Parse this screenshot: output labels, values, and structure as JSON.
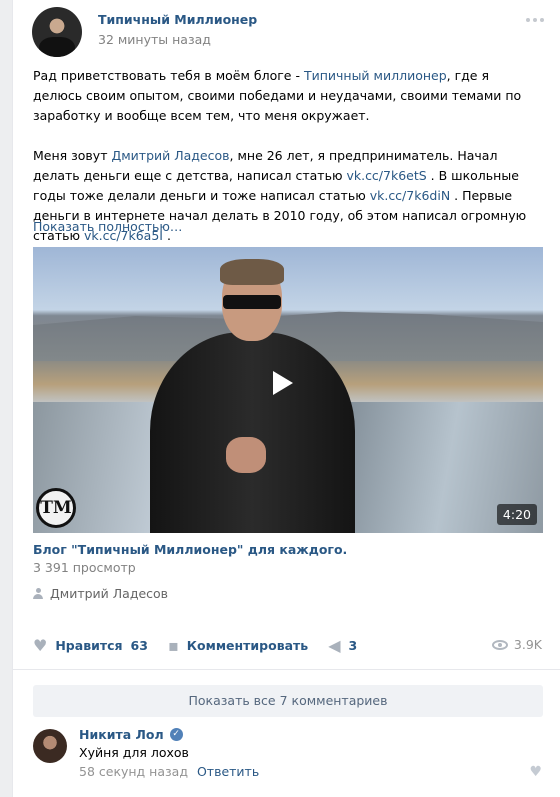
{
  "post": {
    "author": "Типичный Миллионер",
    "time": "32 минуты назад",
    "paragraph1": {
      "before": "Рад приветствовать тебя в моём блоге - ",
      "link": "Типичный миллионер",
      "after": ", где я делюсь своим опытом, своими победами и неудачами, своими темами по заработку и вообще всем тем, что меня окружает."
    },
    "paragraph2": {
      "t1": "Меня зовут ",
      "name_link": "Дмитрий Ладесов",
      "t2": ", мне 26 лет, я предприниматель. Начал делать деньги еще с детства, написал статью ",
      "link1": "vk.cc/7k6etS",
      "t3": " . В школьные годы тоже делали деньги и тоже написал статью ",
      "link2": "vk.cc/7k6diN",
      "t4": " . Первые деньги в интернете начал делать в 2010 году, об этом написал огромную статью ",
      "link3": "vk.cc/7k6a5I",
      "t5": " ."
    },
    "show_more": "Показать полностью…"
  },
  "video": {
    "duration": "4:20",
    "logo_text": "ТМ",
    "title": "Блог \"Типичный Миллионер\" для каждого.",
    "views": "3 391 просмотр",
    "signer": "Дмитрий Ладесов",
    "play_icon": "play-icon"
  },
  "actions": {
    "like_label": "Нравится",
    "like_count": "63",
    "comment_label": "Комментировать",
    "share_count": "3",
    "views": "3.9K"
  },
  "comments": {
    "show_all": "Показать все 7 комментариев",
    "items": [
      {
        "author": "Никита Лол",
        "verified": true,
        "text": "Хуйня для лохов",
        "time": "58 секунд назад",
        "reply": "Ответить"
      }
    ]
  },
  "colors": {
    "link": "#2a5885",
    "muted": "#828282",
    "background": "#edeef0"
  }
}
